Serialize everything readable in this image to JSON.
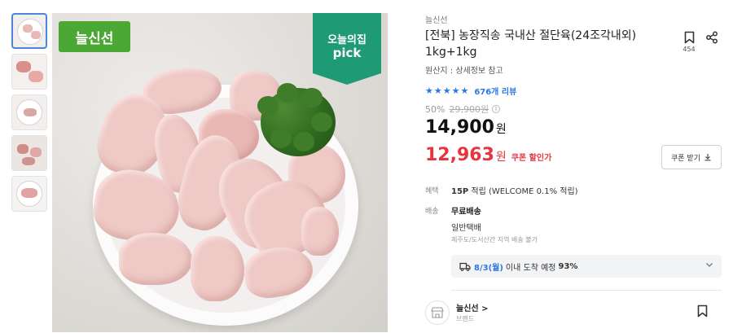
{
  "thumbnails": [
    {
      "label": "thumbnail-1"
    },
    {
      "label": "thumbnail-2"
    },
    {
      "label": "thumbnail-3"
    },
    {
      "label": "thumbnail-4"
    },
    {
      "label": "thumbnail-5"
    }
  ],
  "hero": {
    "brand_badge": "늘신선",
    "pick_line1": "오늘의집",
    "pick_line2": "pick"
  },
  "product": {
    "brand": "늘신선",
    "title": "[전북] 농장직송 국내산 절단육(24조각내외) 1kg+1kg",
    "origin": "원산지 : 상세정보 참고",
    "bookmark_count": "454",
    "stars": "★★★★★",
    "review_count": "676개 리뷰",
    "discount_rate": "50%",
    "original_price": "29,900원",
    "price": "14,900",
    "price_unit": "원",
    "coupon_price": "12,963",
    "coupon_price_unit": "원",
    "coupon_label": "쿠폰 할인가",
    "coupon_button": "쿠폰 받기",
    "colors": {
      "accent": "#2a78e6",
      "sale": "#e8343f",
      "brand_green": "#4ba835",
      "pick_green": "#1e9a74"
    }
  },
  "benefit": {
    "label": "혜택",
    "points": "15P",
    "detail": " 적립 (WELCOME 0.1% 적립)"
  },
  "shipping": {
    "label": "배송",
    "fee": "무료배송",
    "type": "일반택배",
    "note": "제주도/도서산간 지역 배송 불가"
  },
  "delivery": {
    "date": "8/3(월)",
    "text": "이내 도착 예정",
    "percent": "93%"
  },
  "store": {
    "name": "늘신선 >",
    "sub": "브랜드"
  }
}
